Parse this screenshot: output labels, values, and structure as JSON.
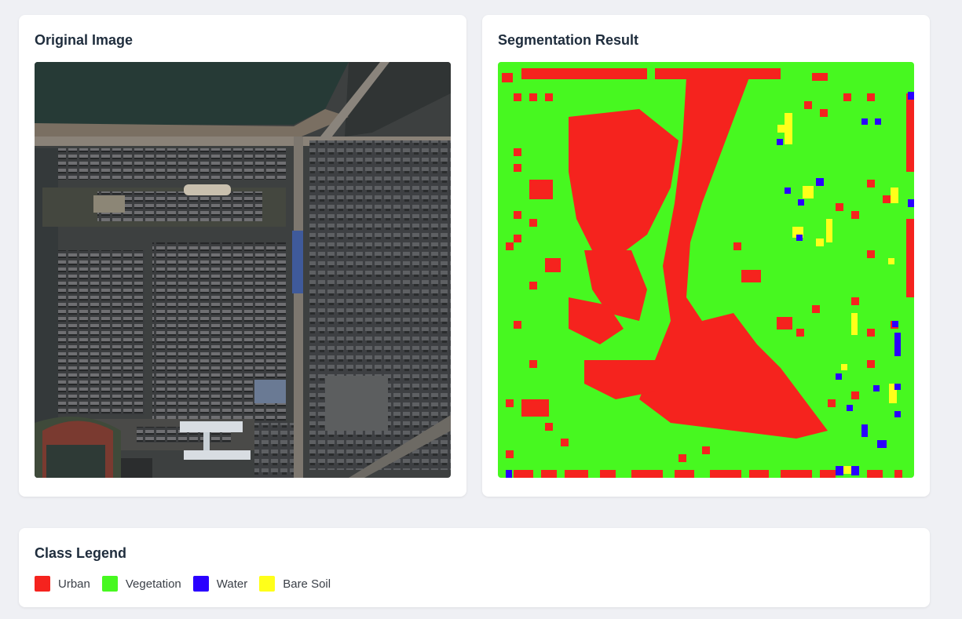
{
  "panels": {
    "original": {
      "title": "Original Image"
    },
    "segmentation": {
      "title": "Segmentation Result"
    }
  },
  "legend": {
    "title": "Class Legend",
    "items": [
      {
        "label": "Urban",
        "color": "#f5231e"
      },
      {
        "label": "Vegetation",
        "color": "#47f820"
      },
      {
        "label": "Water",
        "color": "#2a00ff"
      },
      {
        "label": "Bare Soil",
        "color": "#ffff1a"
      }
    ]
  }
}
